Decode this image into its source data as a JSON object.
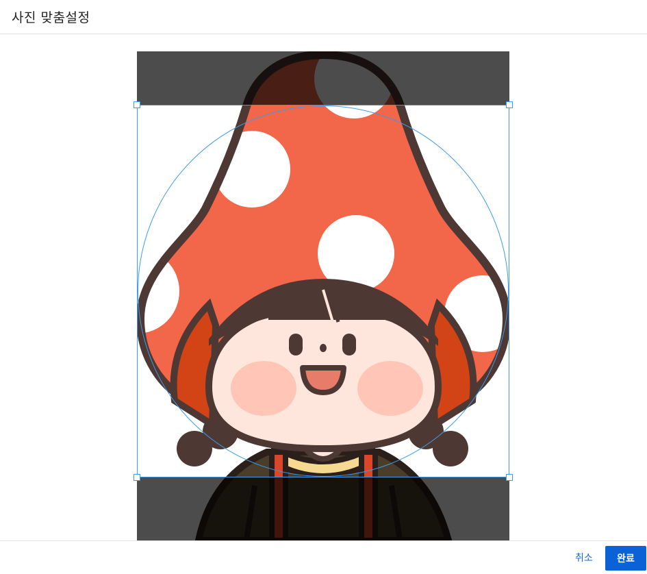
{
  "dialog": {
    "title": "사진 맞춤설정"
  },
  "photo": {
    "description_icon": "mushroom-girl-avatar"
  },
  "footer": {
    "cancel_label": "취소",
    "done_label": "완료"
  },
  "colors": {
    "accent": "#0b62d6",
    "crop_border": "#3d9be9",
    "cap_red": "#f26649",
    "outline_brown": "#4e3834"
  }
}
